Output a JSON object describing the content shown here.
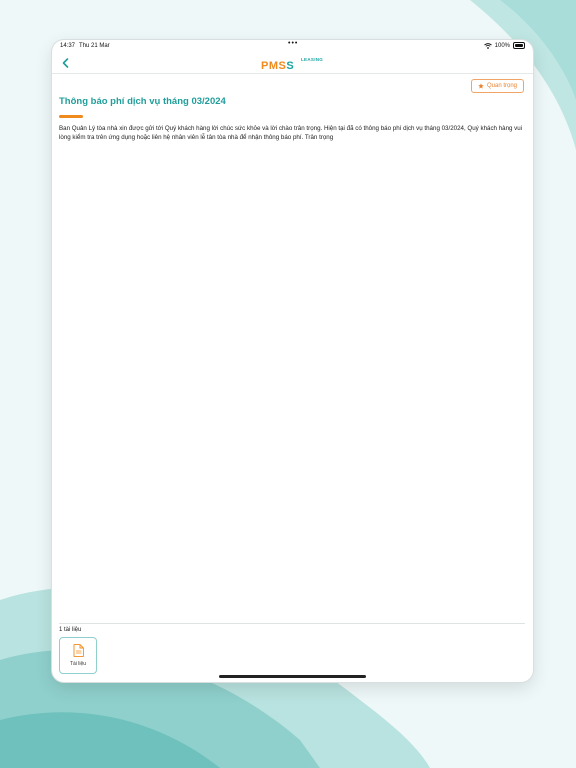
{
  "status_bar": {
    "time": "14:37",
    "date": "Thu 21 Mar",
    "dots": "•••",
    "battery_percent": "100%",
    "icons": [
      "wifi-icon",
      "battery-icon"
    ]
  },
  "nav": {
    "back_icon": "chevron-left-icon",
    "logo_text_a": "PMS",
    "logo_text_b": "S",
    "logo_sub": "LEASING"
  },
  "badge": {
    "icon": "star-icon",
    "label": "Quan trọng"
  },
  "notice": {
    "title": "Thông báo phí dịch vụ tháng 03/2024",
    "body": "Ban Quản Lý tòa nhà xin được gửi tới Quý khách hàng lời chúc sức khỏe và lời chào trân trọng. Hiện tại đã có thông báo phí dịch vụ tháng 03/2024, Quý khách hàng vui lòng kiểm tra trên ứng dụng hoặc liên hệ nhân viên lễ tân tòa nhà để nhận thông báo phí. Trân trọng"
  },
  "attachments": {
    "count_label": "1 tài liệu",
    "items": [
      {
        "label": "Tài liệu",
        "icon": "document-icon"
      }
    ]
  },
  "colors": {
    "brand_teal": "#1f9e9b",
    "brand_orange": "#f08a1c",
    "badge_border": "#f0a566"
  }
}
